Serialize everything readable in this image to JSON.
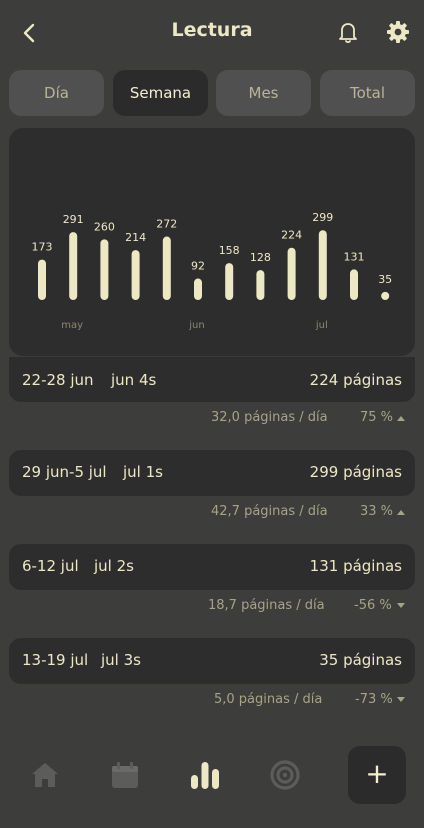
{
  "header": {
    "title": "Lectura"
  },
  "tabs": [
    {
      "label": "Día",
      "active": false
    },
    {
      "label": "Semana",
      "active": true
    },
    {
      "label": "Mes",
      "active": false
    },
    {
      "label": "Total",
      "active": false
    }
  ],
  "chart_data": {
    "type": "bar",
    "values": [
      173,
      291,
      260,
      214,
      272,
      92,
      158,
      128,
      224,
      299,
      131,
      35
    ],
    "month_labels": [
      "may",
      "jun",
      "jul"
    ],
    "bar_color": "#ede8c4"
  },
  "weeks": [
    {
      "range": "22-28 jun",
      "tag": "jun 4s",
      "pages": "224 páginas",
      "avg": "32,0 páginas / día",
      "pct": "75 %",
      "trend": "up"
    },
    {
      "range": "29 jun-5 jul",
      "tag": "jul 1s",
      "pages": "299 páginas",
      "avg": "42,7 páginas / día",
      "pct": "33 %",
      "trend": "up"
    },
    {
      "range": "6-12 jul",
      "tag": "jul 2s",
      "pages": "131 páginas",
      "avg": "18,7 páginas / día",
      "pct": "-56 %",
      "trend": "down"
    },
    {
      "range": "13-19 jul",
      "tag": "jul 3s",
      "pages": "35 páginas",
      "avg": "5,0 páginas / día",
      "pct": "-73 %",
      "trend": "down"
    }
  ],
  "nav": {
    "icons": [
      "home-icon",
      "calendar-icon",
      "stats-icon",
      "target-icon"
    ],
    "add_label": "+"
  },
  "colors": {
    "background": "#3d3d3b",
    "card": "#2d2d2d",
    "accent": "#ede8c4",
    "muted": "#a6a388"
  }
}
